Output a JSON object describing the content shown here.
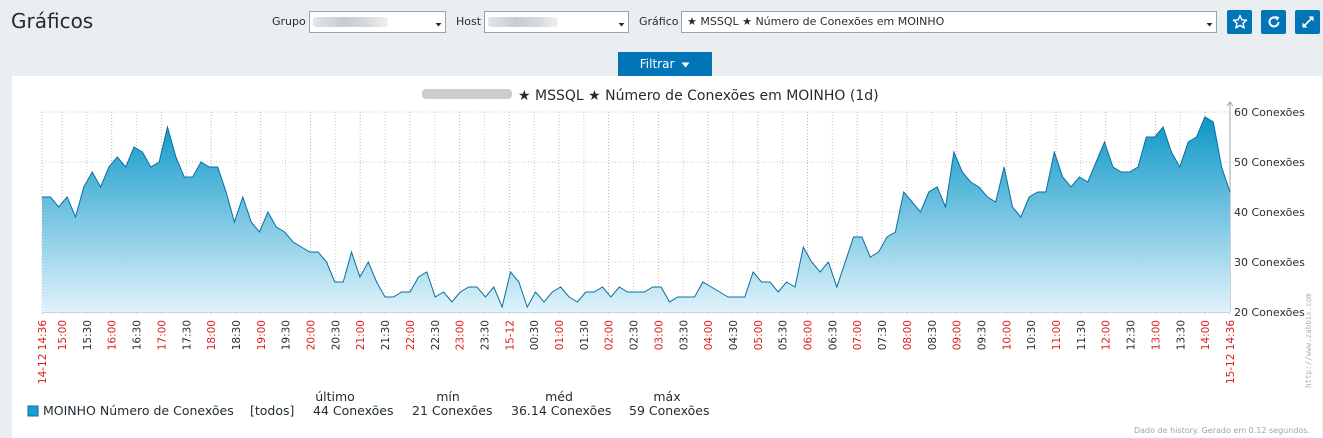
{
  "header": {
    "title": "Gráficos",
    "group_label": "Grupo",
    "group_value": "",
    "host_label": "Host",
    "host_value": "",
    "graph_label": "Gráfico",
    "graph_value": "★ MSSQL ★ Número de Conexões em MOINHO",
    "buttons": [
      "star-icon",
      "refresh-icon",
      "fullscreen-icon"
    ]
  },
  "filter": {
    "label": "Filtrar"
  },
  "colors": {
    "accent": "#0275b8",
    "series_fill": "#1aa0d0",
    "series_stroke": "#0a6fa0",
    "red_tick": "#dd1a1a"
  },
  "chart_data": {
    "type": "area",
    "title": "★ MSSQL ★ Número de Conexões em MOINHO (1d)",
    "ylim": [
      20,
      60
    ],
    "yticks": [
      "60 Conexões",
      "50 Conexões",
      "40 Conexões",
      "30 Conexões",
      "20 Conexões"
    ],
    "xticks": [
      {
        "label": "14-12 14:36",
        "red": true
      },
      {
        "label": "15:00",
        "red": true
      },
      {
        "label": "15:30",
        "red": false
      },
      {
        "label": "16:00",
        "red": true
      },
      {
        "label": "16:30",
        "red": false
      },
      {
        "label": "17:00",
        "red": true
      },
      {
        "label": "17:30",
        "red": false
      },
      {
        "label": "18:00",
        "red": true
      },
      {
        "label": "18:30",
        "red": false
      },
      {
        "label": "19:00",
        "red": true
      },
      {
        "label": "19:30",
        "red": false
      },
      {
        "label": "20:00",
        "red": true
      },
      {
        "label": "20:30",
        "red": false
      },
      {
        "label": "21:00",
        "red": true
      },
      {
        "label": "21:30",
        "red": false
      },
      {
        "label": "22:00",
        "red": true
      },
      {
        "label": "22:30",
        "red": false
      },
      {
        "label": "23:00",
        "red": true
      },
      {
        "label": "23:30",
        "red": false
      },
      {
        "label": "15-12",
        "red": true
      },
      {
        "label": "00:30",
        "red": false
      },
      {
        "label": "01:00",
        "red": true
      },
      {
        "label": "01:30",
        "red": false
      },
      {
        "label": "02:00",
        "red": true
      },
      {
        "label": "02:30",
        "red": false
      },
      {
        "label": "03:00",
        "red": true
      },
      {
        "label": "03:30",
        "red": false
      },
      {
        "label": "04:00",
        "red": true
      },
      {
        "label": "04:30",
        "red": false
      },
      {
        "label": "05:00",
        "red": true
      },
      {
        "label": "05:30",
        "red": false
      },
      {
        "label": "06:00",
        "red": true
      },
      {
        "label": "06:30",
        "red": false
      },
      {
        "label": "07:00",
        "red": true
      },
      {
        "label": "07:30",
        "red": false
      },
      {
        "label": "08:00",
        "red": true
      },
      {
        "label": "08:30",
        "red": false
      },
      {
        "label": "09:00",
        "red": true
      },
      {
        "label": "09:30",
        "red": false
      },
      {
        "label": "10:00",
        "red": true
      },
      {
        "label": "10:30",
        "red": false
      },
      {
        "label": "11:00",
        "red": true
      },
      {
        "label": "11:30",
        "red": false
      },
      {
        "label": "12:00",
        "red": true
      },
      {
        "label": "12:30",
        "red": false
      },
      {
        "label": "13:00",
        "red": true
      },
      {
        "label": "13:30",
        "red": false
      },
      {
        "label": "14:00",
        "red": true
      },
      {
        "label": "15-12 14:36",
        "red": true
      }
    ],
    "series": [
      {
        "name": "MOINHO Número de Conexões",
        "values": [
          43,
          43,
          41,
          43,
          39,
          45,
          48,
          45,
          49,
          51,
          49,
          53,
          52,
          49,
          50,
          57,
          51,
          47,
          47,
          50,
          49,
          49,
          44,
          38,
          43,
          38,
          36,
          40,
          37,
          36,
          34,
          33,
          32,
          32,
          30,
          26,
          26,
          32,
          27,
          30,
          26,
          23,
          23,
          24,
          24,
          27,
          28,
          23,
          24,
          22,
          24,
          25,
          25,
          23,
          25,
          21,
          28,
          26,
          21,
          24,
          22,
          24,
          25,
          23,
          22,
          24,
          24,
          25,
          23,
          25,
          24,
          24,
          24,
          25,
          25,
          22,
          23,
          23,
          23,
          26,
          25,
          24,
          23,
          23,
          23,
          28,
          26,
          26,
          24,
          26,
          25,
          33,
          30,
          28,
          30,
          25,
          30,
          35,
          35,
          31,
          32,
          35,
          36,
          44,
          42,
          40,
          44,
          45,
          41,
          52,
          48,
          46,
          45,
          43,
          42,
          49,
          41,
          39,
          43,
          44,
          44,
          52,
          47,
          45,
          47,
          46,
          50,
          54,
          49,
          48,
          48,
          49,
          55,
          55,
          57,
          52,
          49,
          54,
          55,
          59,
          58,
          49,
          44
        ]
      }
    ],
    "legend": {
      "headers": [
        "último",
        "mín",
        "méd",
        "máx"
      ],
      "rows": [
        {
          "name": "MOINHO Número de Conexões",
          "func": "[todos]",
          "last": "44 Conexões",
          "min": "21 Conexões",
          "avg": "36.14 Conexões",
          "max": "59 Conexões"
        }
      ]
    },
    "footer": "Dado de history. Gerado em 0.12 segundos.",
    "watermark": "http://www.zabbix.com"
  }
}
